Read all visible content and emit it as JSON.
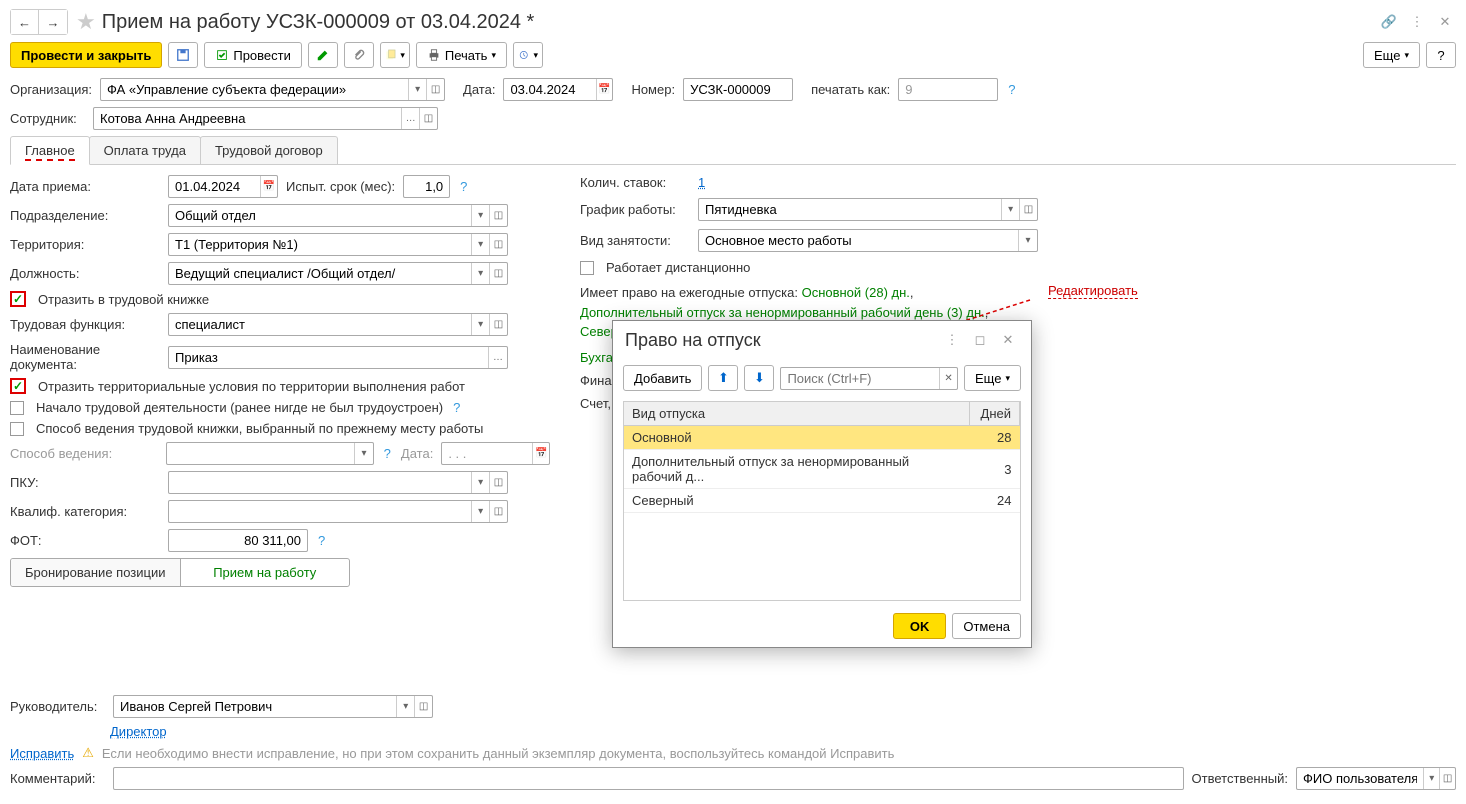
{
  "title": "Прием на работу УСЗК-000009 от 03.04.2024 *",
  "toolbar": {
    "post_close": "Провести и закрыть",
    "post": "Провести",
    "print": "Печать",
    "more": "Еще",
    "help": "?"
  },
  "header": {
    "org_label": "Организация:",
    "org_value": "ФА «Управление субъекта федерации»",
    "date_label": "Дата:",
    "date_value": "03.04.2024",
    "number_label": "Номер:",
    "number_value": "УСЗК-000009",
    "print_as_label": "печатать как:",
    "print_as_value": "9",
    "employee_label": "Сотрудник:",
    "employee_value": "Котова Анна Андреевна"
  },
  "tabs": {
    "main": "Главное",
    "payment": "Оплата труда",
    "contract": "Трудовой договор"
  },
  "main_tab": {
    "hire_date_label": "Дата приема:",
    "hire_date_value": "01.04.2024",
    "probation_label": "Испыт. срок (мес):",
    "probation_value": "1,0",
    "dept_label": "Подразделение:",
    "dept_value": "Общий отдел",
    "territory_label": "Территория:",
    "territory_value": "Т1 (Территория №1)",
    "position_label": "Должность:",
    "position_value": "Ведущий специалист /Общий отдел/",
    "reflect_workbook": "Отразить в трудовой книжке",
    "function_label": "Трудовая функция:",
    "function_value": "специалист",
    "doc_name_label": "Наименование документа:",
    "doc_name_value": "Приказ",
    "reflect_territory": "Отразить территориальные условия по территории выполнения работ",
    "first_job": "Начало трудовой деятельности (ранее нигде не был трудоустроен)",
    "workbook_method": "Способ ведения трудовой книжки, выбранный по прежнему месту работы",
    "method_label": "Способ ведения:",
    "date2_label": "Дата:",
    "date2_value": ". . .",
    "pku_label": "ПКУ:",
    "qualif_label": "Квалиф. категория:",
    "fot_label": "ФОТ:",
    "fot_value": "80 311,00",
    "seg_booking": "Бронирование позиции",
    "seg_hire": "Прием на работу"
  },
  "right_col": {
    "rates_label": "Колич. ставок:",
    "rates_value": "1",
    "schedule_label": "График работы:",
    "schedule_value": "Пятидневка",
    "employment_label": "Вид занятости:",
    "employment_value": "Основное место работы",
    "remote": "Работает дистанционно",
    "vacation_prefix": "Имеет право на ежегодные отпуска: ",
    "vacation_main": "Основной (28) дн.",
    "vacation_extra": "Дополнительный отпуск за ненормированный рабочий день (3) дн.",
    "vacation_north": "Северный (24) дн.",
    "edit_link": "Редактировать",
    "accounting": "Бухгалт",
    "finance": "Финанс",
    "account": "Счет, су"
  },
  "modal": {
    "title": "Право на отпуск",
    "add": "Добавить",
    "search_placeholder": "Поиск (Ctrl+F)",
    "more": "Еще",
    "col_type": "Вид отпуска",
    "col_days": "Дней",
    "rows": [
      {
        "type": "Основной",
        "days": "28"
      },
      {
        "type": "Дополнительный отпуск за ненормированный рабочий д...",
        "days": "3"
      },
      {
        "type": "Северный",
        "days": "24"
      }
    ],
    "ok": "OK",
    "cancel": "Отмена"
  },
  "footer": {
    "manager_label": "Руководитель:",
    "manager_value": "Иванов Сергей Петрович",
    "director": "Директор",
    "fix_link": "Исправить",
    "fix_text": "Если необходимо внести исправление, но при этом сохранить данный экземпляр документа, воспользуйтесь командой Исправить",
    "comment_label": "Комментарий:",
    "responsible_label": "Ответственный:",
    "responsible_value": "ФИО пользователя"
  }
}
